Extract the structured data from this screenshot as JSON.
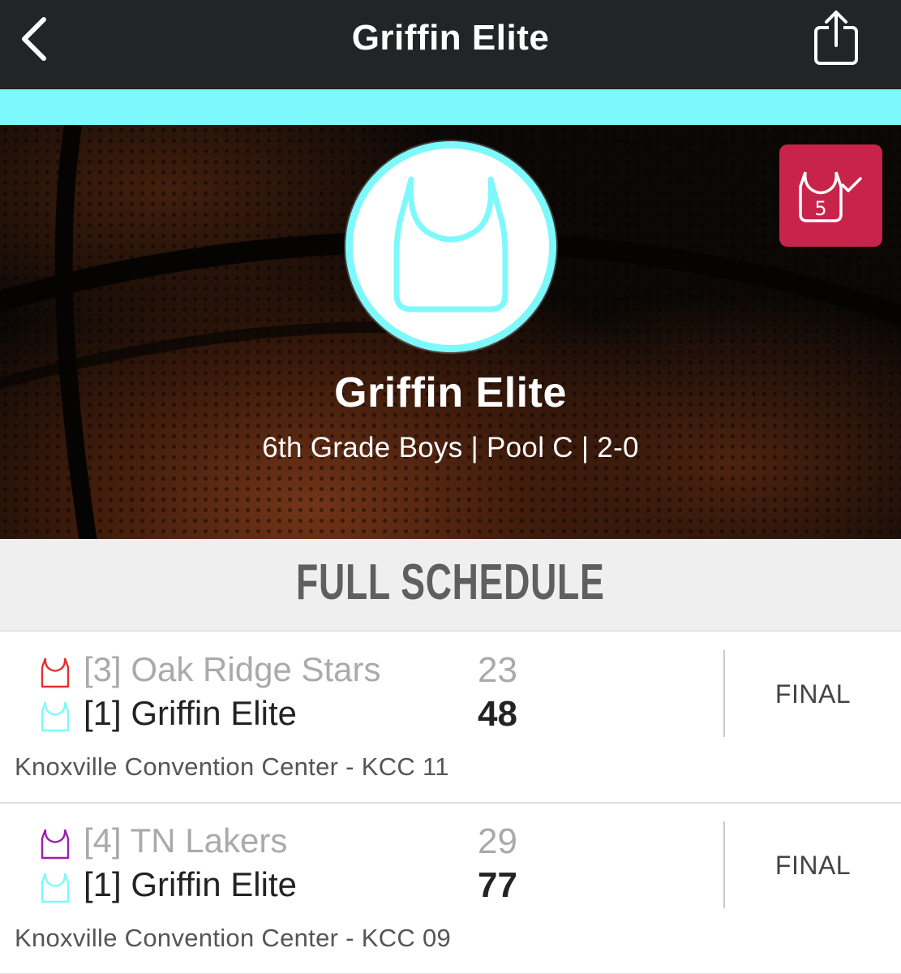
{
  "nav": {
    "title": "Griffin Elite",
    "back_icon": "chevron-left-icon",
    "share_icon": "share-icon"
  },
  "colors": {
    "nav_bg": "#222426",
    "accent": "#7ef9fb",
    "badge_bg": "#c8234a",
    "away_jersey_1": "#e53030",
    "away_jersey_2": "#9b1fb0",
    "home_jersey": "#7ef9fb"
  },
  "hero": {
    "team_name": "Griffin Elite",
    "subtitle": "6th Grade Boys | Pool C | 2-0",
    "badge_icon": "jersey-five-check-icon",
    "badge_number": "5",
    "avatar_icon": "jersey-icon"
  },
  "schedule": {
    "title": "FULL SCHEDULE",
    "games": [
      {
        "away": {
          "name": "[3] Oak Ridge Stars",
          "score": "23",
          "jersey_color": "#e53030"
        },
        "home": {
          "name": "[1] Griffin Elite",
          "score": "48",
          "jersey_color": "#7ef9fb"
        },
        "status": "FINAL",
        "venue": "Knoxville Convention Center - KCC 11"
      },
      {
        "away": {
          "name": "[4] TN Lakers",
          "score": "29",
          "jersey_color": "#9b1fb0"
        },
        "home": {
          "name": "[1] Griffin Elite",
          "score": "77",
          "jersey_color": "#7ef9fb"
        },
        "status": "FINAL",
        "venue": "Knoxville Convention Center - KCC 09"
      }
    ]
  }
}
